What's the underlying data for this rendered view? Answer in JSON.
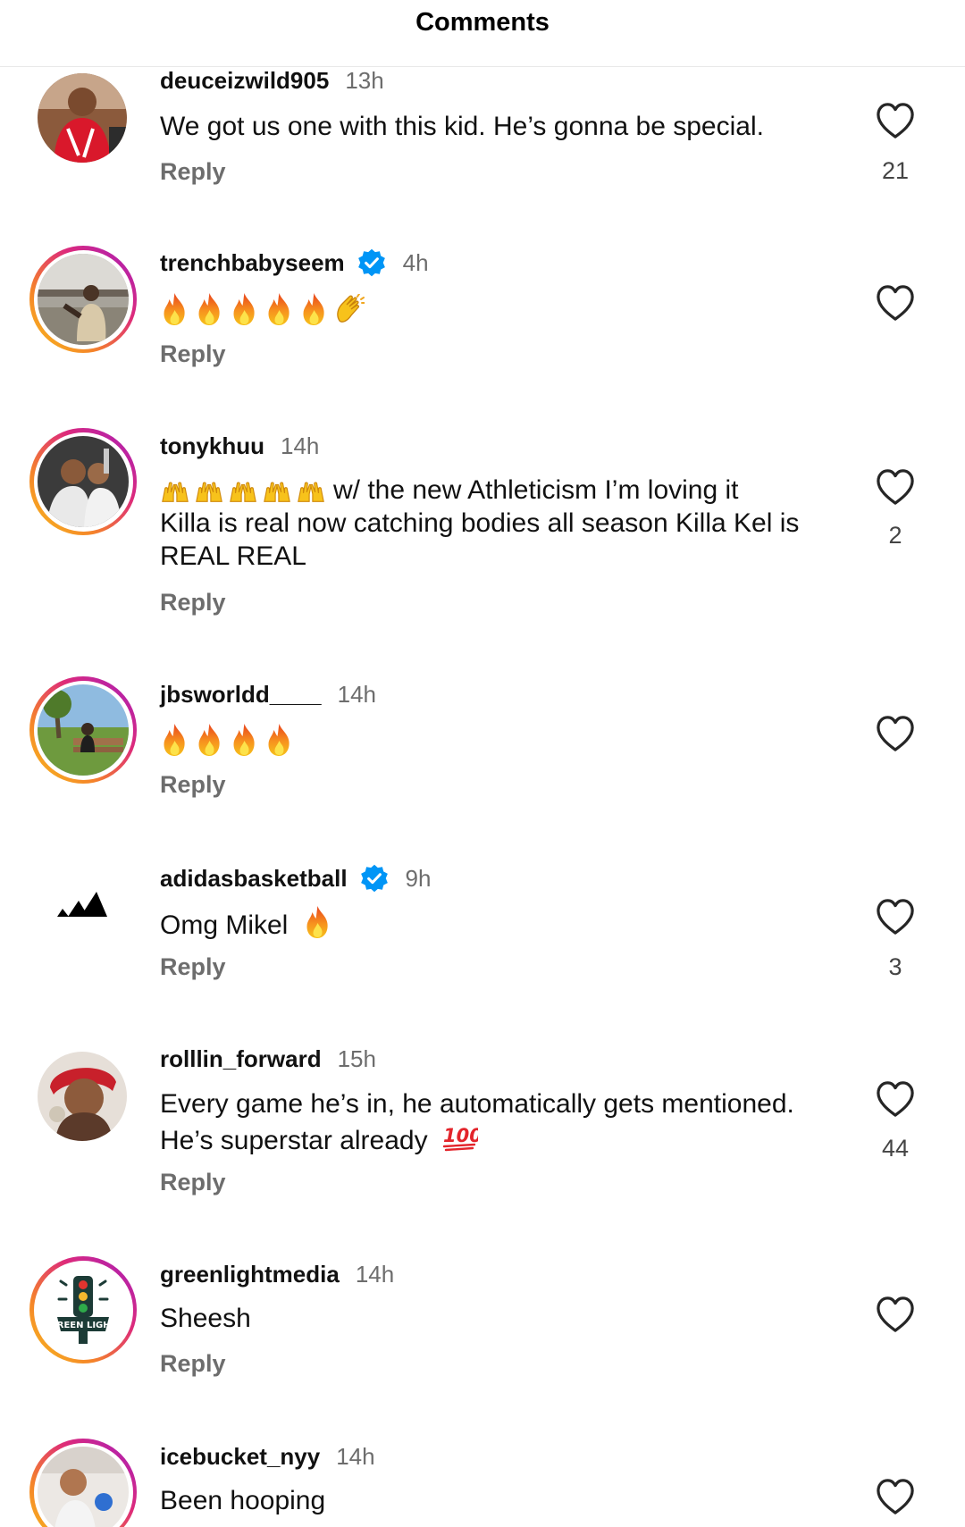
{
  "header": {
    "title": "Comments"
  },
  "reply_label": "Reply",
  "comments": [
    {
      "username": "deuceizwild905",
      "time": "13h",
      "verified": false,
      "text": "We got us one with this kid. He’s gonna be special.",
      "likes": "21",
      "avatar_story_ring": false
    },
    {
      "username": "trenchbabyseem",
      "time": "4h",
      "verified": true,
      "text": "🔥🔥🔥🔥🔥👏",
      "likes": "",
      "avatar_story_ring": true
    },
    {
      "username": "tonykhuu",
      "time": "14h",
      "verified": false,
      "text_line1": "w/  the new Athleticism I’m loving it",
      "text_rest": "Killa is real now catching bodies all season Killa Kel is REAL REAL",
      "text_emojis": "🙌🙌🙌🙌🙌",
      "likes": "2",
      "avatar_story_ring": true
    },
    {
      "username": "jbsworldd____",
      "time": "14h",
      "verified": false,
      "text": "🔥🔥🔥🔥",
      "likes": "",
      "avatar_story_ring": true
    },
    {
      "username": "adidasbasketball",
      "time": "9h",
      "verified": true,
      "text": "Omg Mikel",
      "text_emoji": "🔥",
      "likes": "3",
      "avatar_story_ring": false
    },
    {
      "username": "rolllin_forward",
      "time": "15h",
      "verified": false,
      "text_line1": "Every game he’s in, he automatically gets mentioned.",
      "text_line2": "He’s superstar already",
      "text_emoji": "💯",
      "likes": "44",
      "avatar_story_ring": false
    },
    {
      "username": "greenlightmedia",
      "time": "14h",
      "verified": false,
      "text": "Sheesh",
      "likes": "",
      "avatar_story_ring": true
    },
    {
      "username": "icebucket_nyy",
      "time": "14h",
      "verified": false,
      "text": "Been hooping",
      "likes": "",
      "avatar_story_ring": true
    }
  ],
  "icons": {
    "like": "heart-outline-icon",
    "verified": "verified-badge-icon",
    "fire": "fire-emoji",
    "clap": "clapping-hands-emoji",
    "raised_hands": "raised-hands-emoji",
    "hundred": "hundred-points-emoji"
  },
  "colors": {
    "verified": "#0095f6",
    "secondary_text": "#6d6d6d",
    "story_ring_start": "#f7c11d",
    "story_ring_end": "#a11dc1"
  }
}
